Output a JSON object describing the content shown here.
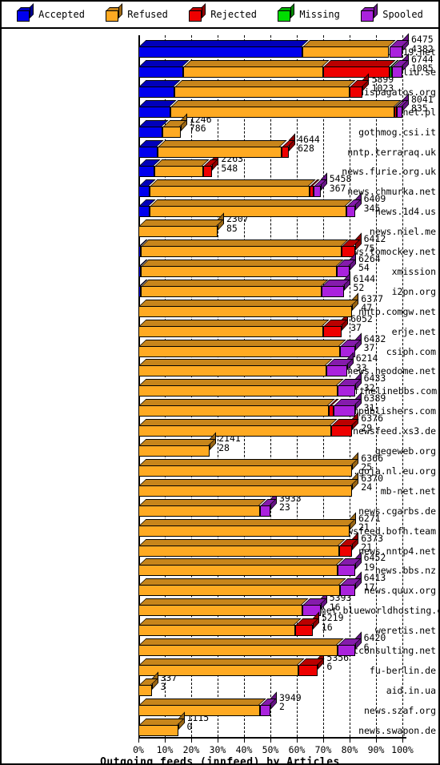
{
  "legend": {
    "items": [
      {
        "label": "Accepted",
        "color": "#0000EE",
        "icon": "cube-icon"
      },
      {
        "label": "Refused",
        "color": "#FFAA22",
        "icon": "cube-icon"
      },
      {
        "label": "Rejected",
        "color": "#EE0000",
        "icon": "cube-icon"
      },
      {
        "label": "Missing",
        "color": "#00DD00",
        "icon": "cube-icon"
      },
      {
        "label": "Spooled",
        "color": "#AA22DD",
        "icon": "cube-icon"
      }
    ]
  },
  "axis": {
    "title": "Outgoing feeds (innfeed) by Articles",
    "xticks": [
      "0%",
      "10%",
      "20%",
      "30%",
      "40%",
      "50%",
      "60%",
      "70%",
      "80%",
      "90%",
      "100%"
    ]
  },
  "chart_data": {
    "type": "bar",
    "orientation": "horizontal",
    "stacked": true,
    "normalized": true,
    "title": "Outgoing feeds (innfeed) by Articles",
    "xlabel": "Outgoing feeds (innfeed) by Articles",
    "ylabel": "",
    "xlim": [
      0,
      100
    ],
    "xticks": [
      0,
      10,
      20,
      30,
      40,
      50,
      60,
      70,
      80,
      90,
      100
    ],
    "grid": true,
    "legend_position": "top",
    "series": [
      "Accepted",
      "Refused",
      "Rejected",
      "Missing",
      "Spooled"
    ],
    "series_colors": [
      "#0000EE",
      "#FFAA22",
      "#EE0000",
      "#00DD00",
      "#AA22DD"
    ],
    "categories": [
      "alt119.net",
      "nyheter.lysator.liu.se",
      "news.hispagatos.org",
      "pionier.net.pl",
      "gothmog.csi.it",
      "nntp.terraraq.uk",
      "news.furie.org.uk",
      "news.chmurka.net",
      "news.1d4.us",
      "news.niel.me",
      "news.tomockey.net",
      "xmission",
      "i2pn.org",
      "nntp.comgw.net",
      "erje.net",
      "csiph.com",
      "news.neodome.net",
      "news.endofthelinebbs.com",
      "news.cmpublishers.com",
      "newsfeed.xs3.de",
      "gegeweb.org",
      "usenet.goja.nl.eu.org",
      "mb-net.net",
      "news.cgarbs.de",
      "newsfeed.bofh.team",
      "news.nntp4.net",
      "news.bbs.nz",
      "news.quux.org",
      "usenet.blueworldhosting.com",
      "weretis.net",
      "tnetconsulting.net",
      "fu-berlin.de",
      "aid.in.ua",
      "news.szaf.org",
      "news.swapon.de"
    ],
    "rows": [
      {
        "name": "alt119.net",
        "total": 6475,
        "secondary": 4382,
        "bar_pct": 100,
        "segments": [
          {
            "s": "Accepted",
            "pct": 62
          },
          {
            "s": "Refused",
            "pct": 33
          },
          {
            "s": "Spooled",
            "pct": 5
          }
        ]
      },
      {
        "name": "nyheter.lysator.liu.se",
        "total": 6744,
        "secondary": 1085,
        "bar_pct": 100,
        "segments": [
          {
            "s": "Accepted",
            "pct": 17
          },
          {
            "s": "Refused",
            "pct": 53
          },
          {
            "s": "Rejected",
            "pct": 25
          },
          {
            "s": "Missing",
            "pct": 1
          },
          {
            "s": "Spooled",
            "pct": 4
          }
        ]
      },
      {
        "name": "news.hispagatos.org",
        "total": 5899,
        "secondary": 1023,
        "bar_pct": 85,
        "segments": [
          {
            "s": "Accepted",
            "pct": 16
          },
          {
            "s": "Refused",
            "pct": 78
          },
          {
            "s": "Rejected",
            "pct": 6
          }
        ]
      },
      {
        "name": "pionier.net.pl",
        "total": 8041,
        "secondary": 835,
        "bar_pct": 100,
        "segments": [
          {
            "s": "Accepted",
            "pct": 12
          },
          {
            "s": "Refused",
            "pct": 85
          },
          {
            "s": "Rejected",
            "pct": 1
          },
          {
            "s": "Spooled",
            "pct": 2
          }
        ]
      },
      {
        "name": "gothmog.csi.it",
        "total": 1246,
        "secondary": 786,
        "bar_pct": 16,
        "segments": [
          {
            "s": "Accepted",
            "pct": 57
          },
          {
            "s": "Refused",
            "pct": 43
          }
        ]
      },
      {
        "name": "nntp.terraraq.uk",
        "total": 4644,
        "secondary": 628,
        "bar_pct": 57,
        "segments": [
          {
            "s": "Accepted",
            "pct": 13
          },
          {
            "s": "Refused",
            "pct": 82
          },
          {
            "s": "Rejected",
            "pct": 5
          }
        ]
      },
      {
        "name": "news.furie.org.uk",
        "total": 2263,
        "secondary": 548,
        "bar_pct": 28,
        "segments": [
          {
            "s": "Accepted",
            "pct": 22
          },
          {
            "s": "Refused",
            "pct": 66
          },
          {
            "s": "Rejected",
            "pct": 12
          }
        ]
      },
      {
        "name": "news.chmurka.net",
        "total": 5458,
        "secondary": 367,
        "bar_pct": 69,
        "segments": [
          {
            "s": "Accepted",
            "pct": 6
          },
          {
            "s": "Refused",
            "pct": 88
          },
          {
            "s": "Rejected",
            "pct": 2
          },
          {
            "s": "Spooled",
            "pct": 4
          }
        ]
      },
      {
        "name": "news.1d4.us",
        "total": 6409,
        "secondary": 345,
        "bar_pct": 82,
        "segments": [
          {
            "s": "Accepted",
            "pct": 5
          },
          {
            "s": "Refused",
            "pct": 91
          },
          {
            "s": "Spooled",
            "pct": 4
          }
        ]
      },
      {
        "name": "news.niel.me",
        "total": 2307,
        "secondary": 85,
        "bar_pct": 30,
        "segments": [
          {
            "s": "Refused",
            "pct": 100
          }
        ]
      },
      {
        "name": "news.tomockey.net",
        "total": 6412,
        "secondary": 75,
        "bar_pct": 82,
        "segments": [
          {
            "s": "Accepted",
            "pct": 1
          },
          {
            "s": "Refused",
            "pct": 93
          },
          {
            "s": "Rejected",
            "pct": 6
          }
        ]
      },
      {
        "name": "xmission",
        "total": 6264,
        "secondary": 54,
        "bar_pct": 80,
        "segments": [
          {
            "s": "Accepted",
            "pct": 1
          },
          {
            "s": "Refused",
            "pct": 93
          },
          {
            "s": "Spooled",
            "pct": 6
          }
        ]
      },
      {
        "name": "i2pn.org",
        "total": 6144,
        "secondary": 52,
        "bar_pct": 78,
        "segments": [
          {
            "s": "Accepted",
            "pct": 1
          },
          {
            "s": "Refused",
            "pct": 88
          },
          {
            "s": "Spooled",
            "pct": 11
          }
        ]
      },
      {
        "name": "nntp.comgw.net",
        "total": 6377,
        "secondary": 47,
        "bar_pct": 81,
        "segments": [
          {
            "s": "Refused",
            "pct": 100
          }
        ]
      },
      {
        "name": "erje.net",
        "total": 6052,
        "secondary": 37,
        "bar_pct": 77,
        "segments": [
          {
            "s": "Refused",
            "pct": 91
          },
          {
            "s": "Rejected",
            "pct": 9
          }
        ]
      },
      {
        "name": "csiph.com",
        "total": 6432,
        "secondary": 37,
        "bar_pct": 82,
        "segments": [
          {
            "s": "Refused",
            "pct": 93
          },
          {
            "s": "Spooled",
            "pct": 7
          }
        ]
      },
      {
        "name": "news.neodome.net",
        "total": 6214,
        "secondary": 33,
        "bar_pct": 79,
        "segments": [
          {
            "s": "Refused",
            "pct": 90
          },
          {
            "s": "Spooled",
            "pct": 10
          }
        ]
      },
      {
        "name": "news.endofthelinebbs.com",
        "total": 6433,
        "secondary": 32,
        "bar_pct": 82,
        "segments": [
          {
            "s": "Refused",
            "pct": 92
          },
          {
            "s": "Spooled",
            "pct": 8
          }
        ]
      },
      {
        "name": "news.cmpublishers.com",
        "total": 6389,
        "secondary": 31,
        "bar_pct": 82,
        "segments": [
          {
            "s": "Refused",
            "pct": 88
          },
          {
            "s": "Rejected",
            "pct": 2
          },
          {
            "s": "Spooled",
            "pct": 10
          }
        ]
      },
      {
        "name": "newsfeed.xs3.de",
        "total": 6376,
        "secondary": 29,
        "bar_pct": 81,
        "segments": [
          {
            "s": "Refused",
            "pct": 90
          },
          {
            "s": "Rejected",
            "pct": 10
          }
        ]
      },
      {
        "name": "gegeweb.org",
        "total": 2141,
        "secondary": 28,
        "bar_pct": 27,
        "segments": [
          {
            "s": "Refused",
            "pct": 100
          }
        ]
      },
      {
        "name": "usenet.goja.nl.eu.org",
        "total": 6366,
        "secondary": 25,
        "bar_pct": 81,
        "segments": [
          {
            "s": "Refused",
            "pct": 100
          }
        ]
      },
      {
        "name": "mb-net.net",
        "total": 6370,
        "secondary": 24,
        "bar_pct": 81,
        "segments": [
          {
            "s": "Refused",
            "pct": 100
          }
        ]
      },
      {
        "name": "news.cgarbs.de",
        "total": 3933,
        "secondary": 23,
        "bar_pct": 50,
        "segments": [
          {
            "s": "Refused",
            "pct": 92
          },
          {
            "s": "Spooled",
            "pct": 8
          }
        ]
      },
      {
        "name": "newsfeed.bofh.team",
        "total": 6271,
        "secondary": 21,
        "bar_pct": 80,
        "segments": [
          {
            "s": "Refused",
            "pct": 100
          }
        ]
      },
      {
        "name": "news.nntp4.net",
        "total": 6373,
        "secondary": 21,
        "bar_pct": 81,
        "segments": [
          {
            "s": "Refused",
            "pct": 94
          },
          {
            "s": "Rejected",
            "pct": 6
          }
        ]
      },
      {
        "name": "news.bbs.nz",
        "total": 6452,
        "secondary": 19,
        "bar_pct": 82,
        "segments": [
          {
            "s": "Refused",
            "pct": 92
          },
          {
            "s": "Spooled",
            "pct": 8
          }
        ]
      },
      {
        "name": "news.quux.org",
        "total": 6413,
        "secondary": 17,
        "bar_pct": 82,
        "segments": [
          {
            "s": "Refused",
            "pct": 93
          },
          {
            "s": "Spooled",
            "pct": 7
          }
        ]
      },
      {
        "name": "usenet.blueworldhosting.com",
        "total": 5393,
        "secondary": 16,
        "bar_pct": 69,
        "segments": [
          {
            "s": "Refused",
            "pct": 90
          },
          {
            "s": "Spooled",
            "pct": 10
          }
        ]
      },
      {
        "name": "weretis.net",
        "total": 5219,
        "secondary": 16,
        "bar_pct": 66,
        "segments": [
          {
            "s": "Refused",
            "pct": 90
          },
          {
            "s": "Rejected",
            "pct": 10
          }
        ]
      },
      {
        "name": "tnetconsulting.net",
        "total": 6420,
        "secondary": 6,
        "bar_pct": 82,
        "segments": [
          {
            "s": "Refused",
            "pct": 92
          },
          {
            "s": "Spooled",
            "pct": 8
          }
        ]
      },
      {
        "name": "fu-berlin.de",
        "total": 5356,
        "secondary": 6,
        "bar_pct": 68,
        "segments": [
          {
            "s": "Refused",
            "pct": 89
          },
          {
            "s": "Rejected",
            "pct": 11
          }
        ]
      },
      {
        "name": "aid.in.ua",
        "total": 337,
        "secondary": 3,
        "bar_pct": 5,
        "segments": [
          {
            "s": "Refused",
            "pct": 100
          }
        ]
      },
      {
        "name": "news.szaf.org",
        "total": 3949,
        "secondary": 2,
        "bar_pct": 50,
        "segments": [
          {
            "s": "Refused",
            "pct": 92
          },
          {
            "s": "Spooled",
            "pct": 8
          }
        ]
      },
      {
        "name": "news.swapon.de",
        "total": 1115,
        "secondary": 0,
        "bar_pct": 15,
        "segments": [
          {
            "s": "Refused",
            "pct": 100
          }
        ]
      }
    ]
  }
}
